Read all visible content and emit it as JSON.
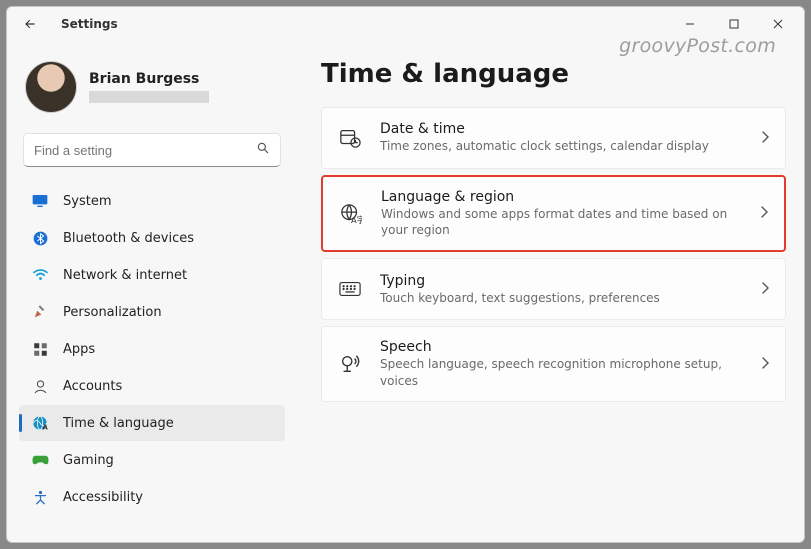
{
  "window": {
    "title": "Settings",
    "watermark": "groovyPost.com"
  },
  "profile": {
    "name": "Brian Burgess"
  },
  "search": {
    "placeholder": "Find a setting"
  },
  "sidebar": {
    "items": [
      {
        "label": "System",
        "icon": "system",
        "active": false
      },
      {
        "label": "Bluetooth & devices",
        "icon": "bt",
        "active": false
      },
      {
        "label": "Network & internet",
        "icon": "wifi",
        "active": false
      },
      {
        "label": "Personalization",
        "icon": "brush",
        "active": false
      },
      {
        "label": "Apps",
        "icon": "apps",
        "active": false
      },
      {
        "label": "Accounts",
        "icon": "account",
        "active": false
      },
      {
        "label": "Time & language",
        "icon": "time",
        "active": true
      },
      {
        "label": "Gaming",
        "icon": "gaming",
        "active": false
      },
      {
        "label": "Accessibility",
        "icon": "access",
        "active": false
      }
    ]
  },
  "main": {
    "title": "Time & language",
    "cards": [
      {
        "icon": "datetime",
        "label": "Date & time",
        "sub": "Time zones, automatic clock settings, calendar display",
        "highlight": false
      },
      {
        "icon": "region",
        "label": "Language & region",
        "sub": "Windows and some apps format dates and time based on your region",
        "highlight": true
      },
      {
        "icon": "typing",
        "label": "Typing",
        "sub": "Touch keyboard, text suggestions, preferences",
        "highlight": false
      },
      {
        "icon": "speech",
        "label": "Speech",
        "sub": "Speech language, speech recognition microphone setup, voices",
        "highlight": false
      }
    ]
  }
}
